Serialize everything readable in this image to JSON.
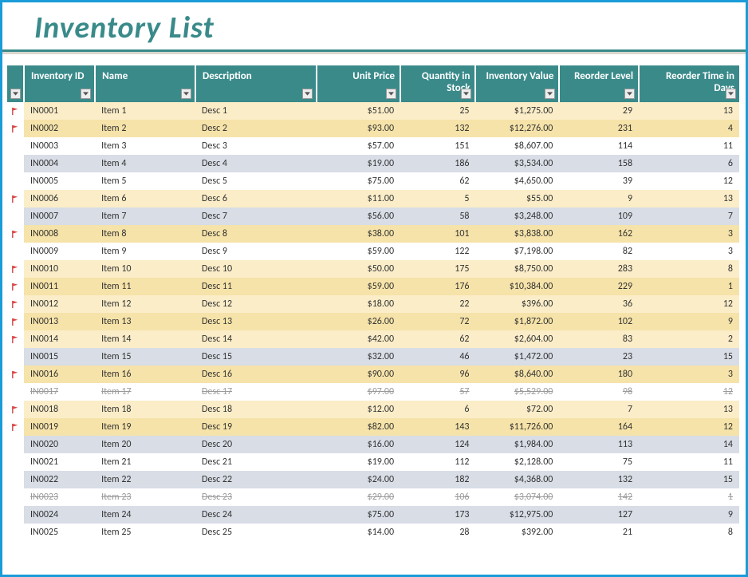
{
  "title": "Inventory List",
  "columns": [
    {
      "key": "id",
      "label": "Inventory ID",
      "align": "left",
      "cls": "c-id"
    },
    {
      "key": "name",
      "label": "Name",
      "align": "left",
      "cls": "c-name"
    },
    {
      "key": "desc",
      "label": "Description",
      "align": "left",
      "cls": "c-desc"
    },
    {
      "key": "price",
      "label": "Unit Price",
      "align": "right",
      "cls": "c-price"
    },
    {
      "key": "qty",
      "label": "Quantity in Stock",
      "align": "right",
      "cls": "c-qty"
    },
    {
      "key": "value",
      "label": "Inventory Value",
      "align": "right",
      "cls": "c-val"
    },
    {
      "key": "reorder",
      "label": "Reorder Level",
      "align": "right",
      "cls": "c-reord"
    },
    {
      "key": "days",
      "label": "Reorder Time in Days",
      "align": "right",
      "cls": "c-days"
    }
  ],
  "rows": [
    {
      "flag": true,
      "id": "IN0001",
      "name": "Item 1",
      "desc": "Desc 1",
      "price": "$51.00",
      "qty": "25",
      "value": "$1,275.00",
      "reorder": "29",
      "days": "13",
      "disc": false
    },
    {
      "flag": true,
      "id": "IN0002",
      "name": "Item 2",
      "desc": "Desc 2",
      "price": "$93.00",
      "qty": "132",
      "value": "$12,276.00",
      "reorder": "231",
      "days": "4",
      "disc": false
    },
    {
      "flag": false,
      "id": "IN0003",
      "name": "Item 3",
      "desc": "Desc 3",
      "price": "$57.00",
      "qty": "151",
      "value": "$8,607.00",
      "reorder": "114",
      "days": "11",
      "disc": false
    },
    {
      "flag": false,
      "id": "IN0004",
      "name": "Item 4",
      "desc": "Desc 4",
      "price": "$19.00",
      "qty": "186",
      "value": "$3,534.00",
      "reorder": "158",
      "days": "6",
      "disc": false
    },
    {
      "flag": false,
      "id": "IN0005",
      "name": "Item 5",
      "desc": "Desc 5",
      "price": "$75.00",
      "qty": "62",
      "value": "$4,650.00",
      "reorder": "39",
      "days": "12",
      "disc": false
    },
    {
      "flag": true,
      "id": "IN0006",
      "name": "Item 6",
      "desc": "Desc 6",
      "price": "$11.00",
      "qty": "5",
      "value": "$55.00",
      "reorder": "9",
      "days": "13",
      "disc": false
    },
    {
      "flag": false,
      "id": "IN0007",
      "name": "Item 7",
      "desc": "Desc 7",
      "price": "$56.00",
      "qty": "58",
      "value": "$3,248.00",
      "reorder": "109",
      "days": "7",
      "disc": false
    },
    {
      "flag": true,
      "id": "IN0008",
      "name": "Item 8",
      "desc": "Desc 8",
      "price": "$38.00",
      "qty": "101",
      "value": "$3,838.00",
      "reorder": "162",
      "days": "3",
      "disc": false
    },
    {
      "flag": false,
      "id": "IN0009",
      "name": "Item 9",
      "desc": "Desc 9",
      "price": "$59.00",
      "qty": "122",
      "value": "$7,198.00",
      "reorder": "82",
      "days": "3",
      "disc": false
    },
    {
      "flag": true,
      "id": "IN0010",
      "name": "Item 10",
      "desc": "Desc 10",
      "price": "$50.00",
      "qty": "175",
      "value": "$8,750.00",
      "reorder": "283",
      "days": "8",
      "disc": false
    },
    {
      "flag": true,
      "id": "IN0011",
      "name": "Item 11",
      "desc": "Desc 11",
      "price": "$59.00",
      "qty": "176",
      "value": "$10,384.00",
      "reorder": "229",
      "days": "1",
      "disc": false
    },
    {
      "flag": true,
      "id": "IN0012",
      "name": "Item 12",
      "desc": "Desc 12",
      "price": "$18.00",
      "qty": "22",
      "value": "$396.00",
      "reorder": "36",
      "days": "12",
      "disc": false
    },
    {
      "flag": true,
      "id": "IN0013",
      "name": "Item 13",
      "desc": "Desc 13",
      "price": "$26.00",
      "qty": "72",
      "value": "$1,872.00",
      "reorder": "102",
      "days": "9",
      "disc": false
    },
    {
      "flag": true,
      "id": "IN0014",
      "name": "Item 14",
      "desc": "Desc 14",
      "price": "$42.00",
      "qty": "62",
      "value": "$2,604.00",
      "reorder": "83",
      "days": "2",
      "disc": false
    },
    {
      "flag": false,
      "id": "IN0015",
      "name": "Item 15",
      "desc": "Desc 15",
      "price": "$32.00",
      "qty": "46",
      "value": "$1,472.00",
      "reorder": "23",
      "days": "15",
      "disc": false
    },
    {
      "flag": true,
      "id": "IN0016",
      "name": "Item 16",
      "desc": "Desc 16",
      "price": "$90.00",
      "qty": "96",
      "value": "$8,640.00",
      "reorder": "180",
      "days": "3",
      "disc": false
    },
    {
      "flag": false,
      "id": "IN0017",
      "name": "Item 17",
      "desc": "Desc 17",
      "price": "$97.00",
      "qty": "57",
      "value": "$5,529.00",
      "reorder": "98",
      "days": "12",
      "disc": true
    },
    {
      "flag": true,
      "id": "IN0018",
      "name": "Item 18",
      "desc": "Desc 18",
      "price": "$12.00",
      "qty": "6",
      "value": "$72.00",
      "reorder": "7",
      "days": "13",
      "disc": false
    },
    {
      "flag": true,
      "id": "IN0019",
      "name": "Item 19",
      "desc": "Desc 19",
      "price": "$82.00",
      "qty": "143",
      "value": "$11,726.00",
      "reorder": "164",
      "days": "12",
      "disc": false
    },
    {
      "flag": false,
      "id": "IN0020",
      "name": "Item 20",
      "desc": "Desc 20",
      "price": "$16.00",
      "qty": "124",
      "value": "$1,984.00",
      "reorder": "113",
      "days": "14",
      "disc": false
    },
    {
      "flag": false,
      "id": "IN0021",
      "name": "Item 21",
      "desc": "Desc 21",
      "price": "$19.00",
      "qty": "112",
      "value": "$2,128.00",
      "reorder": "75",
      "days": "11",
      "disc": false
    },
    {
      "flag": false,
      "id": "IN0022",
      "name": "Item 22",
      "desc": "Desc 22",
      "price": "$24.00",
      "qty": "182",
      "value": "$4,368.00",
      "reorder": "132",
      "days": "15",
      "disc": false
    },
    {
      "flag": false,
      "id": "IN0023",
      "name": "Item 23",
      "desc": "Desc 23",
      "price": "$29.00",
      "qty": "106",
      "value": "$3,074.00",
      "reorder": "142",
      "days": "1",
      "disc": true
    },
    {
      "flag": false,
      "id": "IN0024",
      "name": "Item 24",
      "desc": "Desc 24",
      "price": "$75.00",
      "qty": "173",
      "value": "$12,975.00",
      "reorder": "127",
      "days": "9",
      "disc": false
    },
    {
      "flag": false,
      "id": "IN0025",
      "name": "Item 25",
      "desc": "Desc 25",
      "price": "$14.00",
      "qty": "28",
      "value": "$392.00",
      "reorder": "21",
      "days": "8",
      "disc": false
    }
  ]
}
